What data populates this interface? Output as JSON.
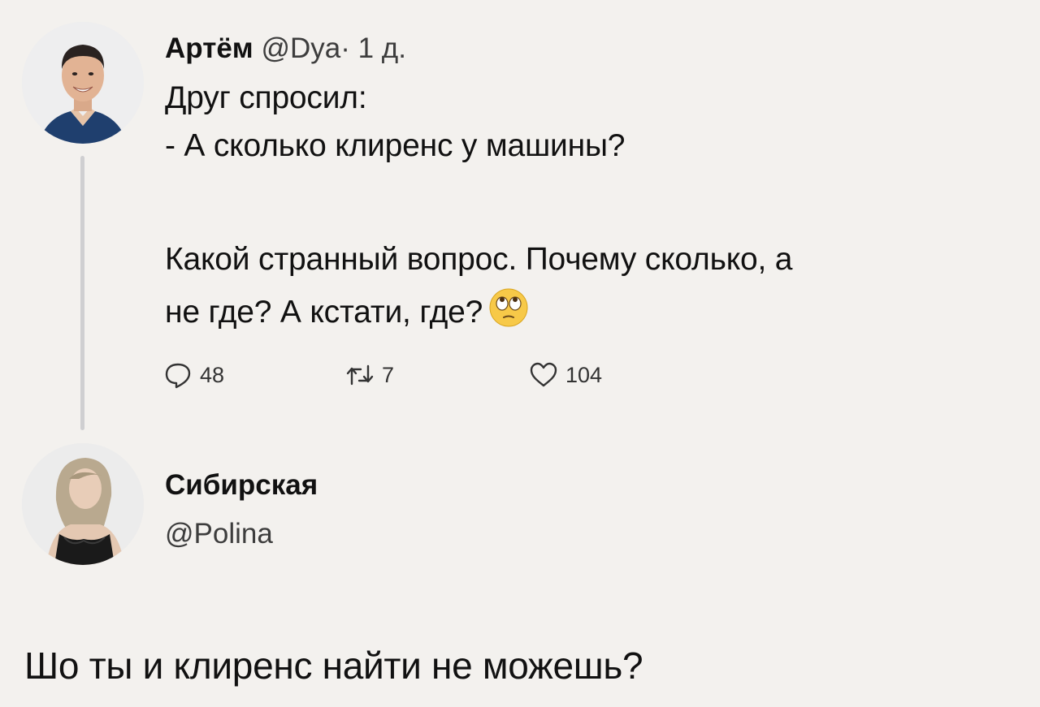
{
  "tweet": {
    "author": "Артём",
    "handle": "@Dya",
    "separator": "·",
    "time": "1 д.",
    "lines": [
      "Друг спросил:",
      "- А сколько клиренс у машины?",
      "Какой странный вопрос. Почему сколько, а",
      "не где? А кстати, где?"
    ],
    "emoji": "face-with-rolling-eyes-icon",
    "actions": {
      "reply_count": "48",
      "retweet_count": "7",
      "like_count": "104"
    }
  },
  "reply": {
    "author": "Сибирская",
    "handle": "@Polina",
    "text": "Шо ты и клиренс найти не можешь?"
  },
  "colors": {
    "background": "#f3f1ee",
    "text": "#111111",
    "secondary_text": "#3d3d3d",
    "thread_line": "#cfcfd1"
  }
}
